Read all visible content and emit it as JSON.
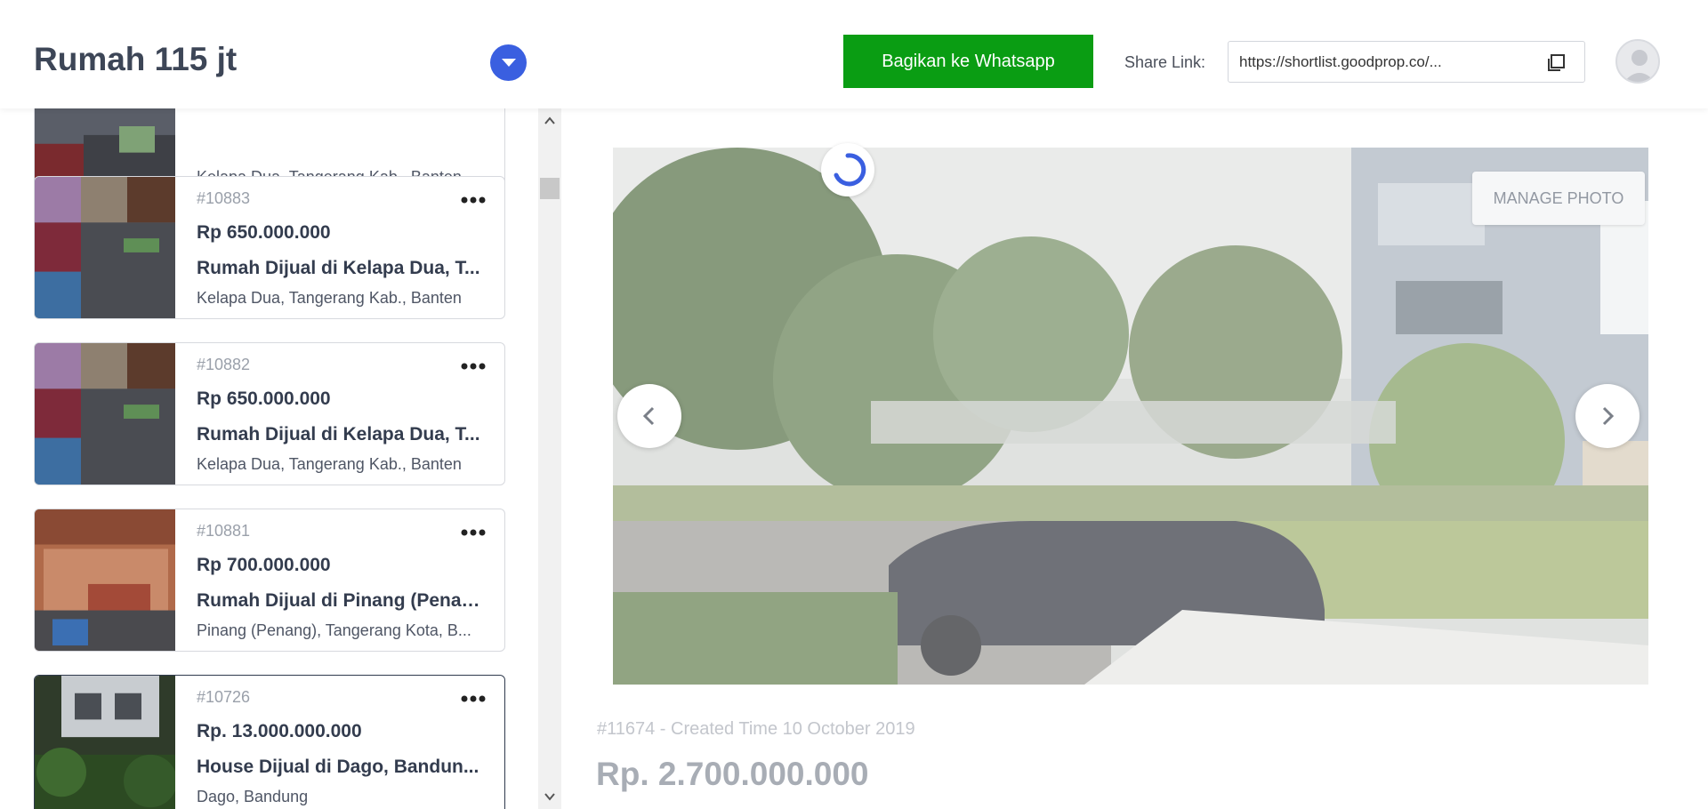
{
  "header": {
    "title": "Rumah 115 jt",
    "whatsapp_button": "Bagikan ke Whatsapp",
    "share_label": "Share Link:",
    "share_value": "https://shortlist.goodprop.co/...",
    "icons": {
      "dropdown": "chevron-down-icon",
      "copy": "copy-icon",
      "avatar": "user-avatar-icon"
    },
    "colors": {
      "accent": "#3a5fe0",
      "whatsapp": "#0a9d13"
    }
  },
  "sidebar": {
    "partial_card": {
      "location": "Kelapa Dua, Tangerang Kab., Banten"
    },
    "items": [
      {
        "id": "#10883",
        "price": "Rp 650.000.000",
        "title": "Rumah Dijual di Kelapa Dua, T...",
        "location": "Kelapa Dua, Tangerang Kab., Banten"
      },
      {
        "id": "#10882",
        "price": "Rp 650.000.000",
        "title": "Rumah Dijual di Kelapa Dua, T...",
        "location": "Kelapa Dua, Tangerang Kab., Banten"
      },
      {
        "id": "#10881",
        "price": "Rp 700.000.000",
        "title": "Rumah Dijual di Pinang (Penan...",
        "location": "Pinang (Penang), Tangerang Kota, B..."
      },
      {
        "id": "#10726",
        "price": "Rp. 13.000.000.000",
        "title": "House Dijual di Dago, Bandun...",
        "location": "Dago, Bandung"
      }
    ]
  },
  "detail": {
    "manage_photo": "MANAGE PHOTO",
    "meta": "#11674 - Created Time 10 October 2019",
    "price": "Rp. 2.700.000.000",
    "icons": {
      "prev": "chevron-left-icon",
      "next": "chevron-right-icon",
      "loading": "spinner-icon"
    }
  }
}
